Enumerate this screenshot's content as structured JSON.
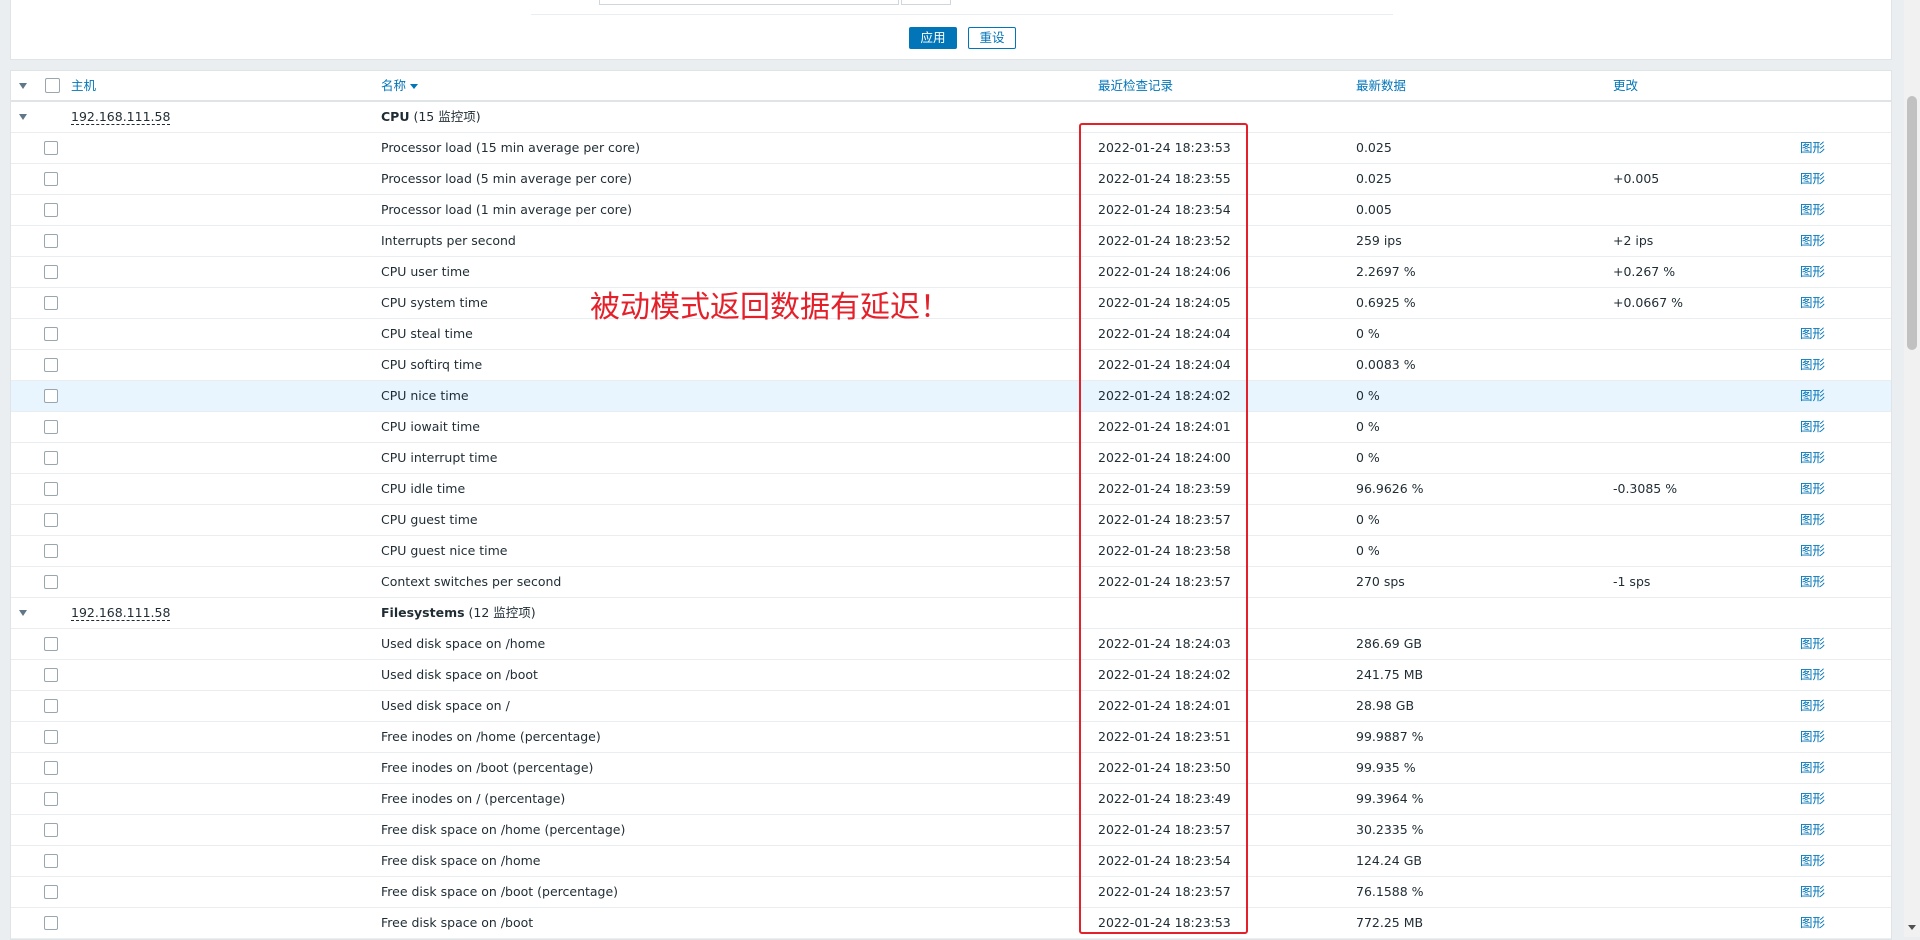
{
  "filter": {
    "apply_label": "应用",
    "reset_label": "重设"
  },
  "table": {
    "headers": {
      "host": "主机",
      "name": "名称",
      "last_check": "最近检查记录",
      "last_value": "最新数据",
      "change": "更改"
    },
    "groups": [
      {
        "host": "192.168.111.58",
        "name_bold": "CPU",
        "count_text": " (15 监控项)",
        "items": [
          {
            "name": "Processor load (15 min average per core)",
            "time": "2022-01-24 18:23:53",
            "value": "0.025",
            "change": "",
            "link": "图形"
          },
          {
            "name": "Processor load (5 min average per core)",
            "time": "2022-01-24 18:23:55",
            "value": "0.025",
            "change": "+0.005",
            "link": "图形"
          },
          {
            "name": "Processor load (1 min average per core)",
            "time": "2022-01-24 18:23:54",
            "value": "0.005",
            "change": "",
            "link": "图形"
          },
          {
            "name": "Interrupts per second",
            "time": "2022-01-24 18:23:52",
            "value": "259 ips",
            "change": "+2 ips",
            "link": "图形"
          },
          {
            "name": "CPU user time",
            "time": "2022-01-24 18:24:06",
            "value": "2.2697 %",
            "change": "+0.267 %",
            "link": "图形"
          },
          {
            "name": "CPU system time",
            "time": "2022-01-24 18:24:05",
            "value": "0.6925 %",
            "change": "+0.0667 %",
            "link": "图形"
          },
          {
            "name": "CPU steal time",
            "time": "2022-01-24 18:24:04",
            "value": "0 %",
            "change": "",
            "link": "图形"
          },
          {
            "name": "CPU softirq time",
            "time": "2022-01-24 18:24:04",
            "value": "0.0083 %",
            "change": "",
            "link": "图形"
          },
          {
            "name": "CPU nice time",
            "time": "2022-01-24 18:24:02",
            "value": "0 %",
            "change": "",
            "link": "图形"
          },
          {
            "name": "CPU iowait time",
            "time": "2022-01-24 18:24:01",
            "value": "0 %",
            "change": "",
            "link": "图形"
          },
          {
            "name": "CPU interrupt time",
            "time": "2022-01-24 18:24:00",
            "value": "0 %",
            "change": "",
            "link": "图形"
          },
          {
            "name": "CPU idle time",
            "time": "2022-01-24 18:23:59",
            "value": "96.9626 %",
            "change": "-0.3085 %",
            "link": "图形"
          },
          {
            "name": "CPU guest time",
            "time": "2022-01-24 18:23:57",
            "value": "0 %",
            "change": "",
            "link": "图形"
          },
          {
            "name": "CPU guest nice time",
            "time": "2022-01-24 18:23:58",
            "value": "0 %",
            "change": "",
            "link": "图形"
          },
          {
            "name": "Context switches per second",
            "time": "2022-01-24 18:23:57",
            "value": "270 sps",
            "change": "-1 sps",
            "link": "图形"
          }
        ]
      },
      {
        "host": "192.168.111.58",
        "name_bold": "Filesystems",
        "count_text": " (12 监控项)",
        "items": [
          {
            "name": "Used disk space on /home",
            "time": "2022-01-24 18:24:03",
            "value": "286.69 GB",
            "change": "",
            "link": "图形"
          },
          {
            "name": "Used disk space on /boot",
            "time": "2022-01-24 18:24:02",
            "value": "241.75 MB",
            "change": "",
            "link": "图形"
          },
          {
            "name": "Used disk space on /",
            "time": "2022-01-24 18:24:01",
            "value": "28.98 GB",
            "change": "",
            "link": "图形"
          },
          {
            "name": "Free inodes on /home (percentage)",
            "time": "2022-01-24 18:23:51",
            "value": "99.9887 %",
            "change": "",
            "link": "图形"
          },
          {
            "name": "Free inodes on /boot (percentage)",
            "time": "2022-01-24 18:23:50",
            "value": "99.935 %",
            "change": "",
            "link": "图形"
          },
          {
            "name": "Free inodes on / (percentage)",
            "time": "2022-01-24 18:23:49",
            "value": "99.3964 %",
            "change": "",
            "link": "图形"
          },
          {
            "name": "Free disk space on /home (percentage)",
            "time": "2022-01-24 18:23:57",
            "value": "30.2335 %",
            "change": "",
            "link": "图形"
          },
          {
            "name": "Free disk space on /home",
            "time": "2022-01-24 18:23:54",
            "value": "124.24 GB",
            "change": "",
            "link": "图形"
          },
          {
            "name": "Free disk space on /boot (percentage)",
            "time": "2022-01-24 18:23:57",
            "value": "76.1588 %",
            "change": "",
            "link": "图形"
          },
          {
            "name": "Free disk space on /boot",
            "time": "2022-01-24 18:23:53",
            "value": "772.25 MB",
            "change": "",
            "link": "图形"
          }
        ]
      }
    ]
  },
  "annotation": {
    "text": "被动模式返回数据有延迟！",
    "color": "#e4202a"
  },
  "colors": {
    "accent": "#0275b8",
    "highlight_row": "#e8f5ff"
  }
}
